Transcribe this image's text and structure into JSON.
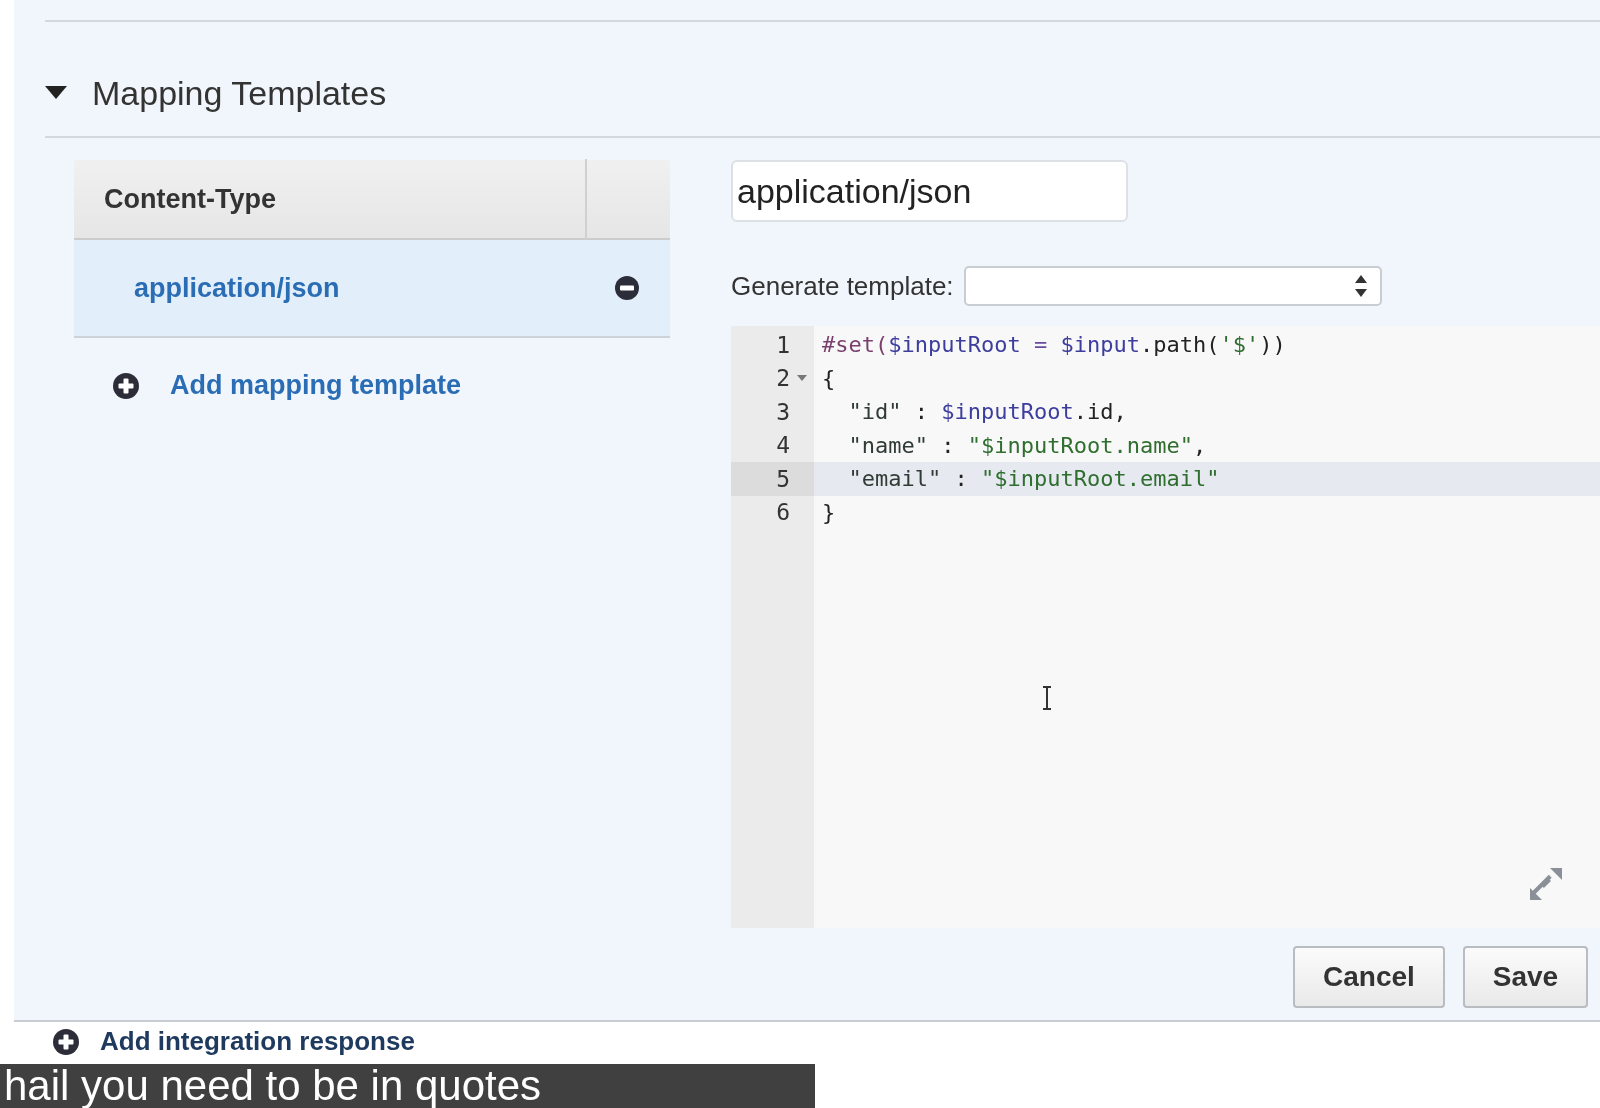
{
  "section": {
    "title": "Mapping Templates",
    "expanded": true
  },
  "content_types": {
    "column_1": "Content-Type",
    "rows": [
      {
        "label": "application/json",
        "selected": true
      }
    ],
    "add_link": "Add mapping template"
  },
  "editor": {
    "content_type_value": "application/json",
    "generate_label": "Generate template:",
    "lines": [
      {
        "number": "1",
        "foldable": false,
        "highlighted": false,
        "tokens": [
          {
            "kind": "directive",
            "text": "#set("
          },
          {
            "kind": "variable",
            "text": "$inputRoot"
          },
          {
            "kind": "operator",
            "text": " = "
          },
          {
            "kind": "variable",
            "text": "$input"
          },
          {
            "kind": "plain",
            "text": ".path("
          },
          {
            "kind": "string",
            "text": "'$'"
          },
          {
            "kind": "plain",
            "text": "))"
          }
        ]
      },
      {
        "number": "2",
        "foldable": true,
        "highlighted": false,
        "tokens": [
          {
            "kind": "plain",
            "text": "{"
          }
        ]
      },
      {
        "number": "3",
        "foldable": false,
        "highlighted": false,
        "tokens": [
          {
            "kind": "key",
            "text": "  \"id\""
          },
          {
            "kind": "plain",
            "text": " : "
          },
          {
            "kind": "variable",
            "text": "$inputRoot"
          },
          {
            "kind": "plain",
            "text": ".id,"
          }
        ]
      },
      {
        "number": "4",
        "foldable": false,
        "highlighted": false,
        "tokens": [
          {
            "kind": "key",
            "text": "  \"name\""
          },
          {
            "kind": "plain",
            "text": " : "
          },
          {
            "kind": "string",
            "text": "\"$inputRoot.name\""
          },
          {
            "kind": "plain",
            "text": ","
          }
        ]
      },
      {
        "number": "5",
        "foldable": false,
        "highlighted": true,
        "tokens": [
          {
            "kind": "key",
            "text": "  \"email\""
          },
          {
            "kind": "plain",
            "text": " : "
          },
          {
            "kind": "string",
            "text": "\"$inputRoot.email\""
          }
        ]
      },
      {
        "number": "6",
        "foldable": false,
        "highlighted": false,
        "tokens": [
          {
            "kind": "plain",
            "text": "}"
          }
        ]
      }
    ]
  },
  "buttons": [
    {
      "label": "Cancel"
    },
    {
      "label": "Save"
    }
  ],
  "next_link": "Add integration response",
  "caption": "hail you need to be in quotes"
}
